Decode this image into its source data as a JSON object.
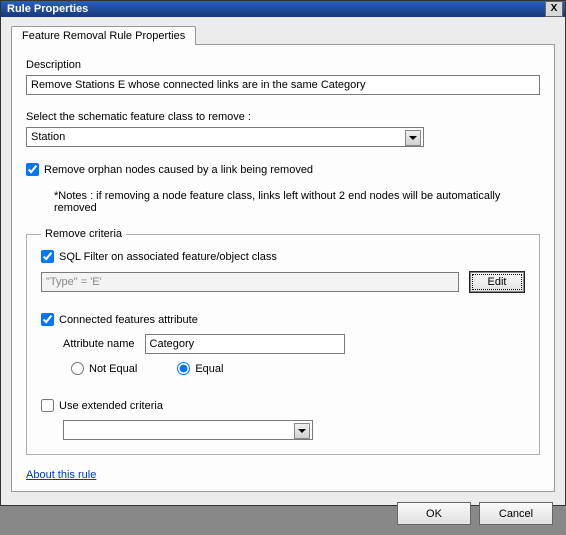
{
  "window": {
    "title": "Rule Properties",
    "close_label": "X"
  },
  "tab": {
    "label": "Feature Removal Rule Properties"
  },
  "description": {
    "label": "Description",
    "value": "Remove Stations E whose connected links are in the same Category"
  },
  "featureClass": {
    "label": "Select the schematic feature class to remove :",
    "value": "Station"
  },
  "orphan": {
    "label": "Remove orphan nodes caused by a link being removed",
    "checked": true
  },
  "notes": "*Notes : if removing a node feature class, links left without 2 end nodes will be automatically removed",
  "criteria": {
    "legend": "Remove criteria",
    "sqlFilter": {
      "label": "SQL Filter on associated feature/object class",
      "checked": true,
      "value": "\"Type\" = 'E'",
      "editLabel": "Edit"
    },
    "connected": {
      "label": "Connected features attribute",
      "checked": true,
      "attrNameLabel": "Attribute name",
      "attrNameValue": "Category",
      "radios": {
        "notEqual": "Not Equal",
        "equal": "Equal",
        "selected": "equal"
      }
    },
    "extended": {
      "label": "Use extended criteria",
      "checked": false,
      "value": ""
    }
  },
  "aboutLink": "About this rule",
  "buttons": {
    "ok": "OK",
    "cancel": "Cancel"
  }
}
